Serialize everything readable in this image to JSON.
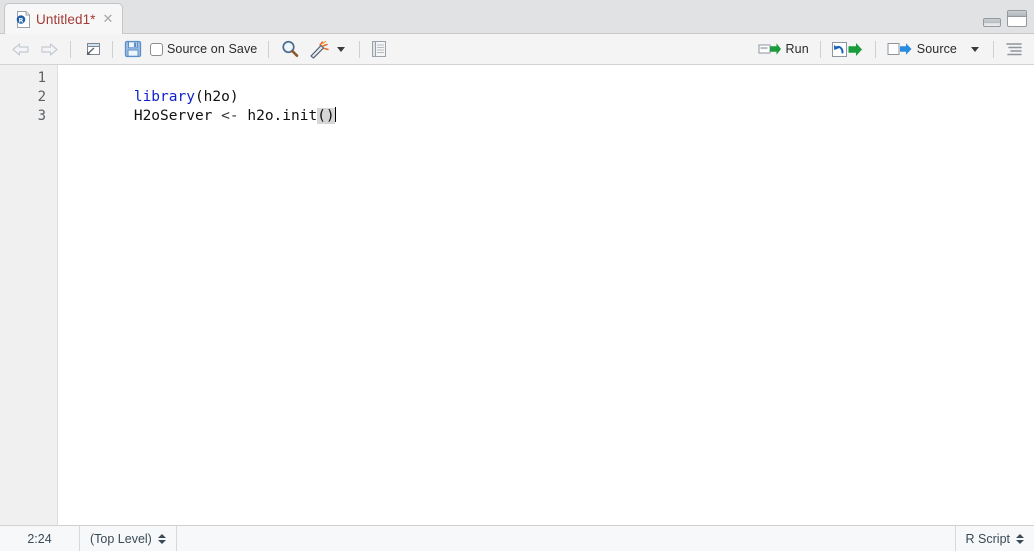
{
  "window": {
    "pane_minimize_label": "Minimize Pane",
    "pane_maximize_label": "Maximize Pane"
  },
  "tab": {
    "label": "Untitled1*",
    "close": "✕",
    "icon": "r-script-file-icon"
  },
  "toolbar": {
    "back_label": "Back",
    "forward_label": "Forward",
    "popout_label": "Show in new window",
    "save_label": "Save current document",
    "source_on_save_label": "Source on Save",
    "find_label": "Find/Replace",
    "magic_label": "Code Tools",
    "compile_report_label": "Compile Report",
    "run_label": "Run",
    "rerun_label": "Re-run the previous code region",
    "source_label": "Source",
    "outline_label": "Show document outline"
  },
  "editor": {
    "gutter": [
      "1",
      "2",
      "3"
    ],
    "lines": [
      {
        "tokens": [
          {
            "text": "library",
            "type": "fn"
          },
          {
            "text": "(h2o)",
            "type": "txt"
          }
        ]
      },
      {
        "tokens": [
          {
            "text": "H2oServer ",
            "type": "txt"
          },
          {
            "text": "<-",
            "type": "op"
          },
          {
            "text": " h2o.init",
            "type": "txt"
          },
          {
            "text": "()",
            "type": "match"
          }
        ]
      },
      {
        "tokens": []
      }
    ],
    "plain_text": "library(h2o)\nH2oServer <- h2o.init()\n"
  },
  "statusbar": {
    "cursor_position": "2:24",
    "scope": "(Top Level)",
    "file_type": "R Script"
  },
  "colors": {
    "tab_label": "#a33a36",
    "keyword": "#1122cc",
    "gutter_bg": "#f0f0f0",
    "toolbar_bg": "#f4f4f4",
    "tabbar_bg": "#e1e2e4",
    "statusbar_bg": "#f7f8f9",
    "run_arrow": "#1a9b3c",
    "source_arrow": "#2a8ce0",
    "rerun_arrow": "#1560bd",
    "save_icon": "#5b8fc9"
  }
}
